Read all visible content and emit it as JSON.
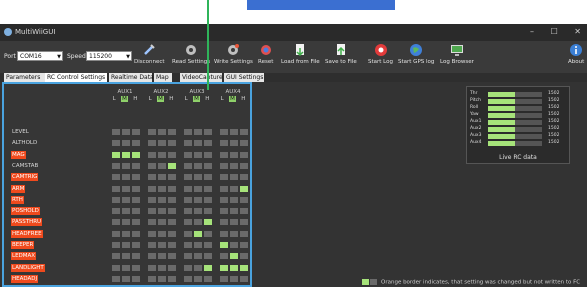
{
  "window": {
    "title": "MultiWiiGUI",
    "controls": [
      "–",
      "☐",
      "✕"
    ]
  },
  "toolbar": {
    "port_label": "Port",
    "port_value": "COM16",
    "speed_label": "Speed",
    "speed_value": "115200",
    "buttons": [
      {
        "label": "Disconnect",
        "icon": "plug-icon"
      },
      {
        "label": "Read Settings",
        "icon": "gear-read-icon"
      },
      {
        "label": "Write Settings",
        "icon": "gear-write-icon"
      },
      {
        "label": "Reset",
        "icon": "reset-icon"
      },
      {
        "label": "Load from File",
        "icon": "load-file-icon"
      },
      {
        "label": "Save to File",
        "icon": "save-file-icon"
      },
      {
        "label": "Start Log",
        "icon": "record-icon"
      },
      {
        "label": "Start GPS log",
        "icon": "globe-icon"
      },
      {
        "label": "Log Browser",
        "icon": "monitor-icon"
      },
      {
        "label": "About",
        "icon": "info-icon"
      }
    ]
  },
  "tabs": [
    "Parameters",
    "RC Control Settings",
    "Realtime Data",
    "Map",
    "VideoCapture",
    "GUI Settings"
  ],
  "active_tab": 1,
  "aux_columns": [
    {
      "label": "AUX1",
      "lmh": [
        "L",
        "M",
        "H"
      ]
    },
    {
      "label": "AUX2",
      "lmh": [
        "L",
        "M",
        "H"
      ]
    },
    {
      "label": "AUX3",
      "lmh": [
        "L",
        "M",
        "H"
      ]
    },
    {
      "label": "AUX4",
      "lmh": [
        "L",
        "M",
        "H"
      ]
    }
  ],
  "modes": [
    {
      "name": "LEVEL",
      "changed": false,
      "states": [
        [
          0,
          0,
          0
        ],
        [
          0,
          0,
          0
        ],
        [
          0,
          0,
          0
        ],
        [
          0,
          0,
          0
        ]
      ]
    },
    {
      "name": "ALTHOLD",
      "changed": false,
      "states": [
        [
          0,
          0,
          0
        ],
        [
          0,
          0,
          0
        ],
        [
          0,
          0,
          0
        ],
        [
          0,
          0,
          0
        ]
      ]
    },
    {
      "name": "MAG",
      "changed": true,
      "states": [
        [
          1,
          1,
          1
        ],
        [
          0,
          0,
          0
        ],
        [
          0,
          0,
          0
        ],
        [
          0,
          0,
          0
        ]
      ]
    },
    {
      "name": "CAMSTAB",
      "changed": false,
      "states": [
        [
          0,
          0,
          0
        ],
        [
          0,
          0,
          1
        ],
        [
          0,
          0,
          0
        ],
        [
          0,
          0,
          0
        ]
      ]
    },
    {
      "name": "CAMTRIG",
      "changed": true,
      "states": [
        [
          0,
          0,
          0
        ],
        [
          0,
          0,
          0
        ],
        [
          0,
          0,
          0
        ],
        [
          0,
          0,
          0
        ]
      ]
    },
    {
      "name": "ARM",
      "changed": true,
      "states": [
        [
          0,
          0,
          0
        ],
        [
          0,
          0,
          0
        ],
        [
          0,
          0,
          0
        ],
        [
          0,
          0,
          1
        ]
      ]
    },
    {
      "name": "RTH",
      "changed": true,
      "states": [
        [
          0,
          0,
          0
        ],
        [
          0,
          0,
          0
        ],
        [
          0,
          0,
          0
        ],
        [
          0,
          0,
          0
        ]
      ]
    },
    {
      "name": "POSHOLD",
      "changed": true,
      "states": [
        [
          0,
          0,
          0
        ],
        [
          0,
          0,
          0
        ],
        [
          0,
          0,
          0
        ],
        [
          0,
          0,
          0
        ]
      ]
    },
    {
      "name": "PASSTHRU",
      "changed": true,
      "states": [
        [
          0,
          0,
          0
        ],
        [
          0,
          0,
          0
        ],
        [
          0,
          0,
          1
        ],
        [
          0,
          0,
          0
        ]
      ]
    },
    {
      "name": "HEADFREE",
      "changed": true,
      "states": [
        [
          0,
          0,
          0
        ],
        [
          0,
          0,
          0
        ],
        [
          0,
          1,
          0
        ],
        [
          0,
          0,
          0
        ]
      ]
    },
    {
      "name": "BEEPER",
      "changed": true,
      "states": [
        [
          0,
          0,
          0
        ],
        [
          0,
          0,
          0
        ],
        [
          0,
          0,
          0
        ],
        [
          1,
          0,
          0
        ]
      ]
    },
    {
      "name": "LEDMAX",
      "changed": true,
      "states": [
        [
          0,
          0,
          0
        ],
        [
          0,
          0,
          0
        ],
        [
          0,
          0,
          0
        ],
        [
          0,
          1,
          0
        ]
      ]
    },
    {
      "name": "LANDLIGHT",
      "changed": true,
      "states": [
        [
          0,
          0,
          0
        ],
        [
          0,
          0,
          0
        ],
        [
          0,
          0,
          1
        ],
        [
          1,
          1,
          1
        ]
      ]
    },
    {
      "name": "HEADADJ",
      "changed": true,
      "states": [
        [
          0,
          0,
          0
        ],
        [
          0,
          0,
          0
        ],
        [
          0,
          0,
          0
        ],
        [
          0,
          0,
          0
        ]
      ]
    }
  ],
  "live_rc": {
    "title": "Live RC data",
    "channels": [
      {
        "name": "Thr",
        "value": "1502",
        "fill": 0.5
      },
      {
        "name": "Pitch",
        "value": "1502",
        "fill": 0.5
      },
      {
        "name": "Roll",
        "value": "1502",
        "fill": 0.5
      },
      {
        "name": "Yaw",
        "value": "1502",
        "fill": 0.5
      },
      {
        "name": "Aux1",
        "value": "1502",
        "fill": 0.5
      },
      {
        "name": "Aux2",
        "value": "1502",
        "fill": 0.5
      },
      {
        "name": "Aux3",
        "value": "1502",
        "fill": 0.5
      },
      {
        "name": "Aux4",
        "value": "1502",
        "fill": 0.5
      }
    ]
  },
  "legend_text": "Orange border indicates, that setting was changed but not written to FC",
  "colors": {
    "accent": "#4aa3df",
    "active": "#a6e37a",
    "changed": "#ef4a1d",
    "inactive": "#6a6a6a"
  }
}
